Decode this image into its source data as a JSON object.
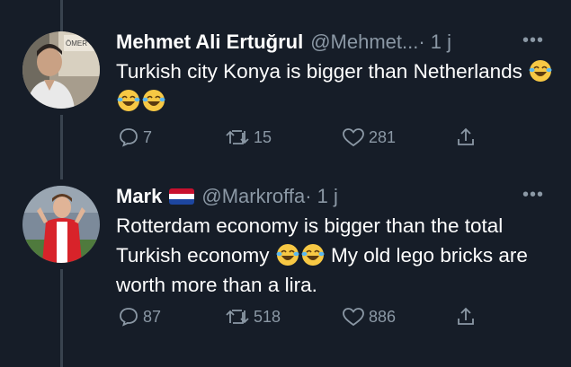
{
  "tweets": [
    {
      "author_name": "Mehmet Ali Ertuğrul",
      "handle": "@Mehmet...",
      "time": " · 1 j",
      "text": "Turkish city Konya is bigger than Netherlands",
      "emojis": [
        "laughing-crying-emoji",
        "laughing-crying-emoji",
        "laughing-crying-emoji"
      ],
      "replies": "7",
      "retweets": "15",
      "likes": "281",
      "avatar_sign_text": "ÖMER"
    },
    {
      "author_name": "Mark",
      "handle": "@Markroffa",
      "time": " · 1 j",
      "text_part1": "Rotterdam economy is bigger than the total Turkish economy",
      "text_part2": "My old lego bricks are worth more than a lira.",
      "emojis": [
        "laughing-crying-emoji",
        "laughing-crying-emoji"
      ],
      "flag": "netherlands-flag-icon",
      "replies": "87",
      "retweets": "518",
      "likes": "886"
    }
  ],
  "colors": {
    "background": "#161d28",
    "text": "#ffffff",
    "muted": "#8b98a5",
    "thread_line": "#39434f"
  }
}
